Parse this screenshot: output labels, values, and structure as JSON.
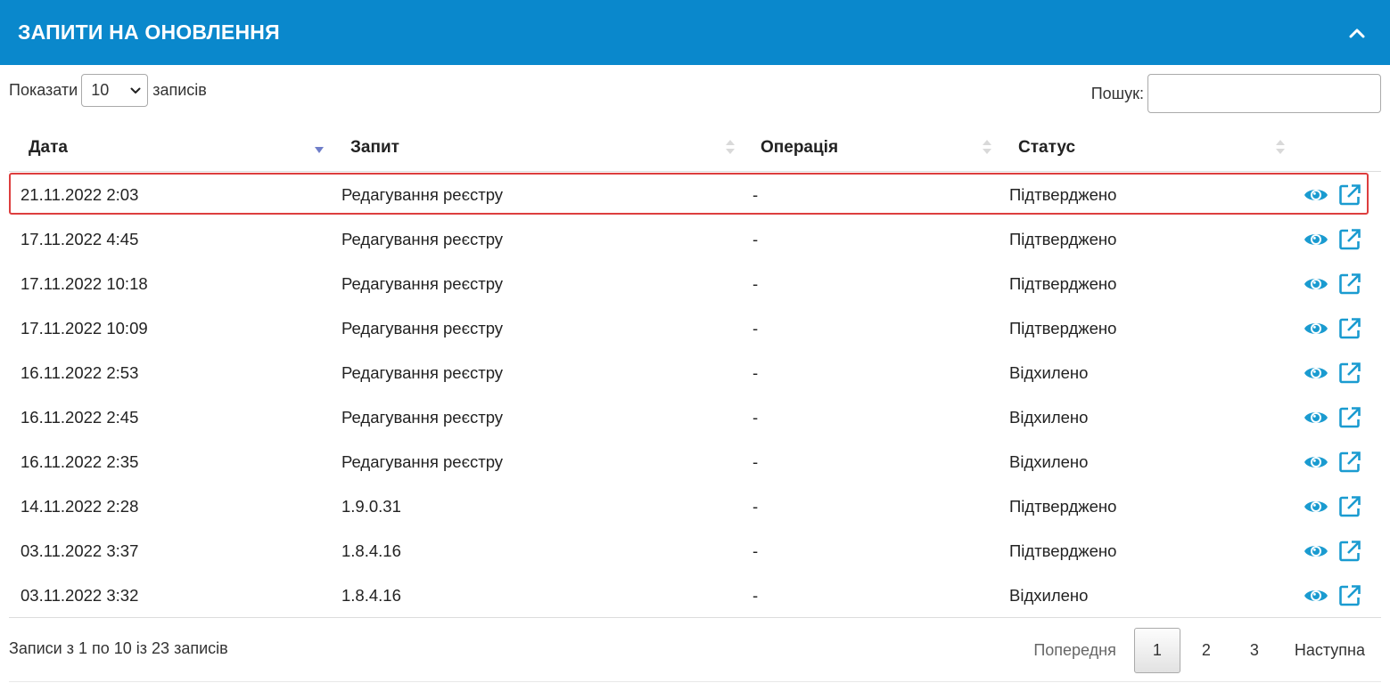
{
  "panel": {
    "title": "Запити на оновлення",
    "collapse_icon": "chevron-up-icon",
    "accent_color": "#0a88cc"
  },
  "length": {
    "prefix": "Показати",
    "value": "10",
    "suffix": "записів"
  },
  "search": {
    "label": "Пошук:",
    "value": ""
  },
  "columns": [
    "Дата",
    "Запит",
    "Операція",
    "Статус"
  ],
  "rows": [
    {
      "date": "21.11.2022 2:03",
      "request": "Редагування реєстру",
      "operation": "-",
      "status": "Підтверджено"
    },
    {
      "date": "17.11.2022 4:45",
      "request": "Редагування реєстру",
      "operation": "-",
      "status": "Підтверджено"
    },
    {
      "date": "17.11.2022 10:18",
      "request": "Редагування реєстру",
      "operation": "-",
      "status": "Підтверджено"
    },
    {
      "date": "17.11.2022 10:09",
      "request": "Редагування реєстру",
      "operation": "-",
      "status": "Підтверджено"
    },
    {
      "date": "16.11.2022 2:53",
      "request": "Редагування реєстру",
      "operation": "-",
      "status": "Відхилено"
    },
    {
      "date": "16.11.2022 2:45",
      "request": "Редагування реєстру",
      "operation": "-",
      "status": "Відхилено"
    },
    {
      "date": "16.11.2022 2:35",
      "request": "Редагування реєстру",
      "operation": "-",
      "status": "Відхилено"
    },
    {
      "date": "14.11.2022 2:28",
      "request": "1.9.0.31",
      "operation": "-",
      "status": "Підтверджено"
    },
    {
      "date": "03.11.2022 3:37",
      "request": "1.8.4.16",
      "operation": "-",
      "status": "Підтверджено"
    },
    {
      "date": "03.11.2022 3:32",
      "request": "1.8.4.16",
      "operation": "-",
      "status": "Відхилено"
    }
  ],
  "row_actions": {
    "view_icon": "eye-icon",
    "open_icon": "external-link-icon",
    "icon_color": "#1a9bd0"
  },
  "footer": {
    "info": "Записи з 1 по 10 із 23 записів",
    "prev": "Попередня",
    "pages": [
      "1",
      "2",
      "3"
    ],
    "current_page": "1",
    "next": "Наступна"
  },
  "highlight_color": "#dd3e3e"
}
